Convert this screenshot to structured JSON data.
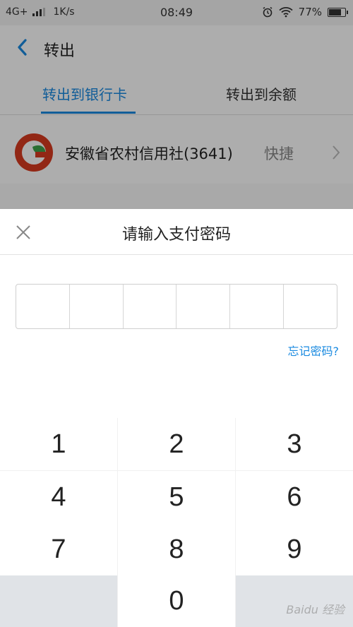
{
  "status_bar": {
    "network": "4G+",
    "speed": "1K/s",
    "time": "08:49",
    "battery": "77%",
    "icons": [
      "signal-icon",
      "alarm-icon",
      "wifi-icon",
      "battery-icon"
    ]
  },
  "header": {
    "title": "转出",
    "back_icon": "chevron-left-icon"
  },
  "tabs": [
    {
      "label": "转出到银行卡",
      "active": true
    },
    {
      "label": "转出到余额",
      "active": false
    }
  ],
  "bank": {
    "name": "安徽省农村信用社(3641)",
    "tag": "快捷"
  },
  "password_sheet": {
    "title": "请输入支付密码",
    "forgot_label": "忘记密码?",
    "pin_length": 6
  },
  "keypad": {
    "keys": [
      "1",
      "2",
      "3",
      "4",
      "5",
      "6",
      "7",
      "8",
      "9",
      "",
      "0",
      ""
    ]
  },
  "watermark": "Baidu 经验",
  "colors": {
    "accent": "#1a8ae0",
    "keypad_blank": "#e0e3e7"
  }
}
